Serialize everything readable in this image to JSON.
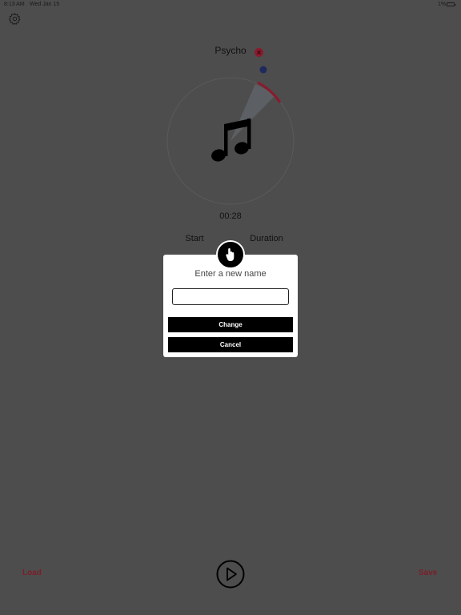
{
  "status_bar": {
    "time": "8:13 AM",
    "date": "Wed Jan 15",
    "battery": "1%"
  },
  "track": {
    "name": "Psycho",
    "elapsed": "00:28"
  },
  "controls": {
    "start_label": "Start",
    "duration_label": "Duration",
    "load_label": "Load",
    "save_label": "Save"
  },
  "dialog": {
    "title": "Enter a new name",
    "input_value": "",
    "input_placeholder": "",
    "change_label": "Change",
    "cancel_label": "Cancel"
  },
  "icons": {
    "settings": "gear-icon",
    "remove": "close-circle-icon",
    "artwork": "music-note-icon",
    "dialog_badge": "hand-pointer-icon",
    "play": "play-icon"
  },
  "colors": {
    "overlay_background": "#4d4d4d",
    "accent_red": "#7a1f2b",
    "arc_red": "#8b1a2c",
    "handle_blue": "#1f2a5c",
    "dialog_background": "#ffffff",
    "button_background": "#000000"
  }
}
